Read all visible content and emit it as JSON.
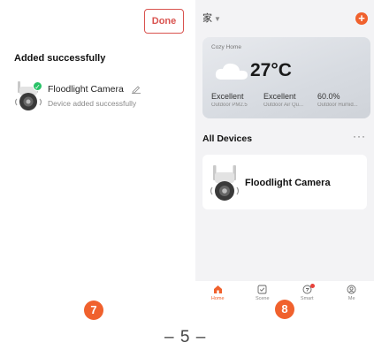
{
  "left_panel": {
    "done_label": "Done",
    "title": "Added successfully",
    "device": {
      "name": "Floodlight Camera",
      "status": "Device added successfully",
      "icon": "floodlight-camera-icon",
      "badge_icon": "check-icon"
    }
  },
  "phone": {
    "home_selector": "家",
    "add_icon": "plus-icon",
    "weather": {
      "home_label": "Cozy Home",
      "temperature": "27°C",
      "icon": "cloud-icon",
      "stats": [
        {
          "value": "Excellent",
          "label": "Outdoor PM2.5"
        },
        {
          "value": "Excellent",
          "label": "Outdoor Air Qu..."
        },
        {
          "value": "60.0%",
          "label": "Outdoor Humid..."
        }
      ]
    },
    "section_title": "All Devices",
    "more_icon": "more-icon",
    "device_card": {
      "name": "Floodlight Camera"
    },
    "tabs": [
      {
        "label": "Home",
        "icon": "home-icon",
        "active": true
      },
      {
        "label": "Scene",
        "icon": "scene-icon",
        "active": false
      },
      {
        "label": "Smart",
        "icon": "smart-icon",
        "active": false
      },
      {
        "label": "Me",
        "icon": "me-icon",
        "active": false
      }
    ]
  },
  "steps": {
    "left": "7",
    "right": "8"
  },
  "page_number": "– 5 –",
  "colors": {
    "accent": "#f0612d",
    "done_border": "#d9534f",
    "success": "#29c267"
  }
}
